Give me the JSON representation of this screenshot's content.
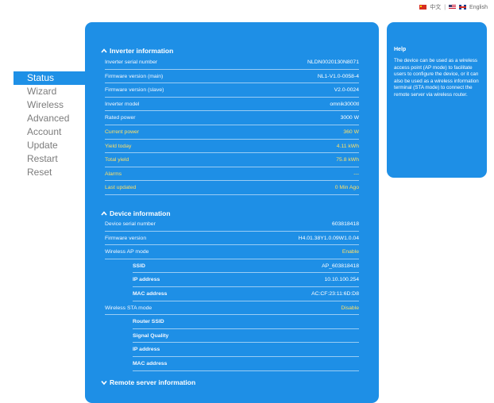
{
  "language": {
    "chinese": "中文",
    "separator": "|",
    "english": "English"
  },
  "sidebar": {
    "items": [
      {
        "label": "Status",
        "active": true
      },
      {
        "label": "Wizard"
      },
      {
        "label": "Wireless"
      },
      {
        "label": "Advanced"
      },
      {
        "label": "Account"
      },
      {
        "label": "Update"
      },
      {
        "label": "Restart"
      },
      {
        "label": "Reset"
      }
    ]
  },
  "inverter": {
    "title": "Inverter information",
    "rows": [
      {
        "label": "Inverter serial number",
        "value": "NLDN0020130N8071"
      },
      {
        "label": "Firmware version (main)",
        "value": "NL1-V1.0-0058-4"
      },
      {
        "label": "Firmware version (slave)",
        "value": "V2.0-0024"
      },
      {
        "label": "Inverter model",
        "value": "omnik3000tl"
      },
      {
        "label": "Rated power",
        "value": "3000 W"
      },
      {
        "label": "Current power",
        "value": "360 W"
      },
      {
        "label": "Yield today",
        "value": "4.11 kWh"
      },
      {
        "label": "Total yield",
        "value": "75.8 kWh"
      },
      {
        "label": "Alarms",
        "value": "---"
      },
      {
        "label": "Last updated",
        "value": "0 Min Ago"
      }
    ]
  },
  "device": {
    "title": "Device information",
    "rows": [
      {
        "label": "Device serial number",
        "value": "603818418"
      },
      {
        "label": "Firmware version",
        "value": "H4.01.38Y1.0.09W1.0.04"
      },
      {
        "label": "Wireless AP mode",
        "value": "Enable"
      },
      {
        "label": "SSID",
        "value": "AP_603818418"
      },
      {
        "label": "IP address",
        "value": "10.10.100.254"
      },
      {
        "label": "MAC address",
        "value": "AC:CF:23:11:6D:D8"
      },
      {
        "label": "Wireless STA mode",
        "value": "Disable"
      },
      {
        "label": "Router SSID",
        "value": ""
      },
      {
        "label": "Signal Quality",
        "value": ""
      },
      {
        "label": "IP address",
        "value": ""
      },
      {
        "label": "MAC address",
        "value": ""
      }
    ]
  },
  "remote": {
    "title": "Remote server information"
  },
  "help": {
    "title": "Help",
    "text": "The device can be used as a wireless access point (AP mode) to facilitate users to configure the device, or it can also be used as a wireless information terminal (STA mode) to connect the remote server via wireless router."
  },
  "colors": {
    "panel": "#1e8fe6",
    "highlight": "#ffe066",
    "nav_active": "#1e90e6"
  }
}
